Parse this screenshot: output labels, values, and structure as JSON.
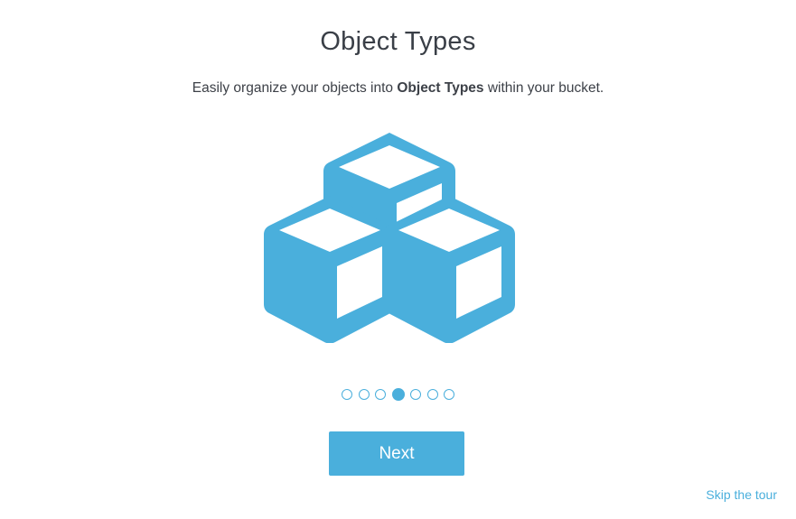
{
  "tour": {
    "title": "Object Types",
    "subtitle_before": "Easily organize your objects into ",
    "subtitle_bold": "Object Types",
    "subtitle_after": " within your bucket.",
    "illustration_icon": "stacked-cubes-icon",
    "step_total": 7,
    "step_current": 4,
    "next_label": "Next",
    "skip_label": "Skip the tour"
  },
  "colors": {
    "accent": "#4aafdc",
    "title_text": "#3a3f47",
    "body_text": "#3d4148",
    "background": "#ffffff"
  }
}
